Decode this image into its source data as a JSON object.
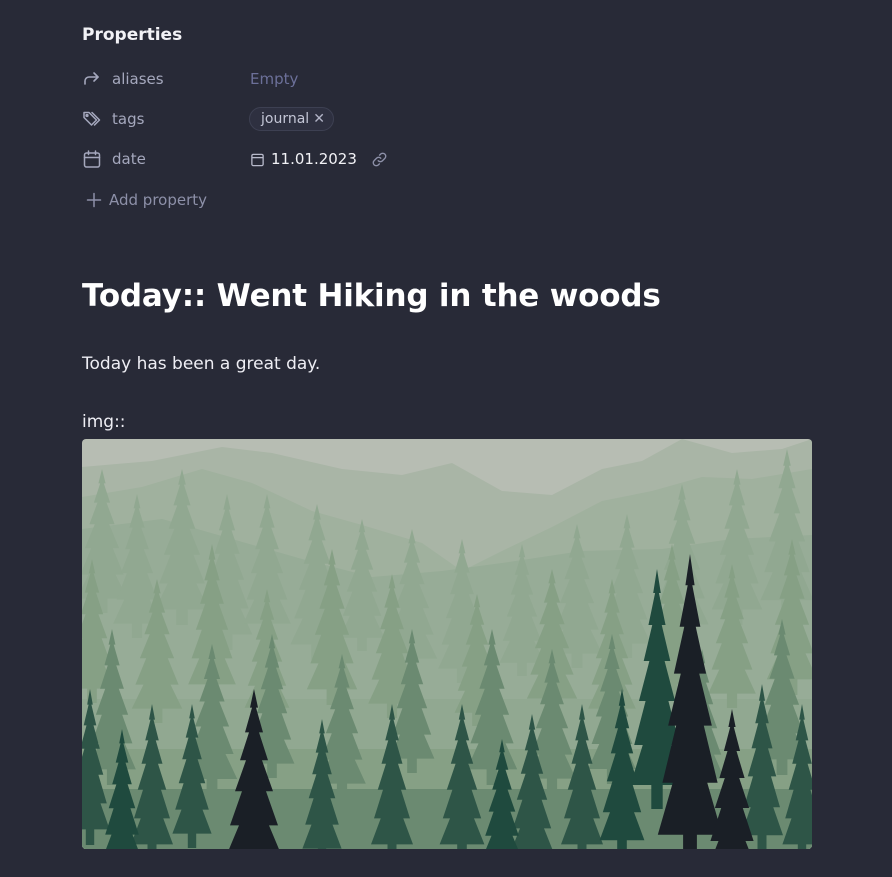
{
  "properties": {
    "heading": "Properties",
    "rows": [
      {
        "key": "aliases",
        "value": "Empty"
      },
      {
        "key": "tags",
        "value": "journal"
      },
      {
        "key": "date",
        "value": "11.01.2023"
      }
    ],
    "add_label": "Add property"
  },
  "note": {
    "title": "Today:: Went Hiking in the woods",
    "paragraph": "Today has been a great day.",
    "image_label": "img::"
  },
  "colors": {
    "background": "#282a37",
    "muted_text": "#a5a8bd",
    "empty_value": "#6c7099"
  },
  "icons": {
    "aliases": "forward-arrow-icon",
    "tags": "tags-icon",
    "date": "calendar-icon",
    "date_value": "calendar-small-icon",
    "link": "link-icon",
    "add": "plus-icon",
    "tag_remove": "close-icon"
  }
}
